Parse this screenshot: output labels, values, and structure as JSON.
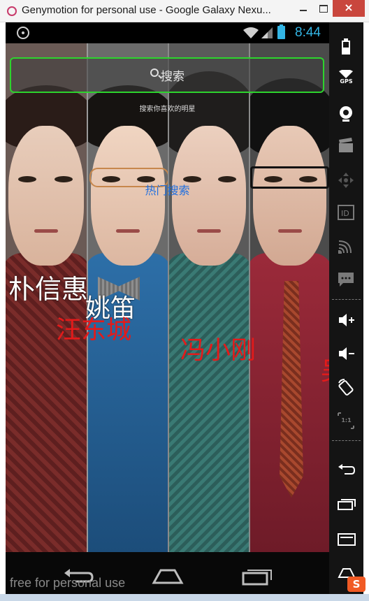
{
  "window": {
    "title": "Genymotion for personal use - Google Galaxy Nexu...",
    "close_label": "×"
  },
  "status_bar": {
    "time": "8:44",
    "icons": [
      "location-target-icon",
      "wifi-icon",
      "signal-icon",
      "battery-icon"
    ]
  },
  "app": {
    "search_label": "搜索",
    "search_hint": "搜索你喜欢的明星",
    "hot_title": "热门搜索",
    "hot_tags": [
      "朴信惠",
      "姚笛",
      "汪东城",
      "冯小刚",
      "吴"
    ]
  },
  "nav_bar": {
    "buttons": [
      "back",
      "home",
      "recent-apps"
    ],
    "watermark": "free for personal use"
  },
  "sidebar": {
    "gps_label": "GPS",
    "ratio_label": "1:1",
    "items": [
      "battery-icon",
      "gps-icon",
      "webcam-icon",
      "clapper-icon",
      "dpad-icon",
      "id-icon",
      "cast-icon",
      "sms-icon",
      "volume-up-icon",
      "volume-down-icon",
      "rotate-icon",
      "scale-icon",
      "back-icon",
      "recent-apps-icon",
      "menu-icon",
      "home-icon"
    ]
  },
  "ime": {
    "label": "S"
  },
  "colors": {
    "accent": "#33b5e5",
    "search_border": "#2dd42d",
    "hot_title": "#1f6fe0",
    "tag_red": "#e41a1a",
    "close_button": "#c9463d"
  }
}
